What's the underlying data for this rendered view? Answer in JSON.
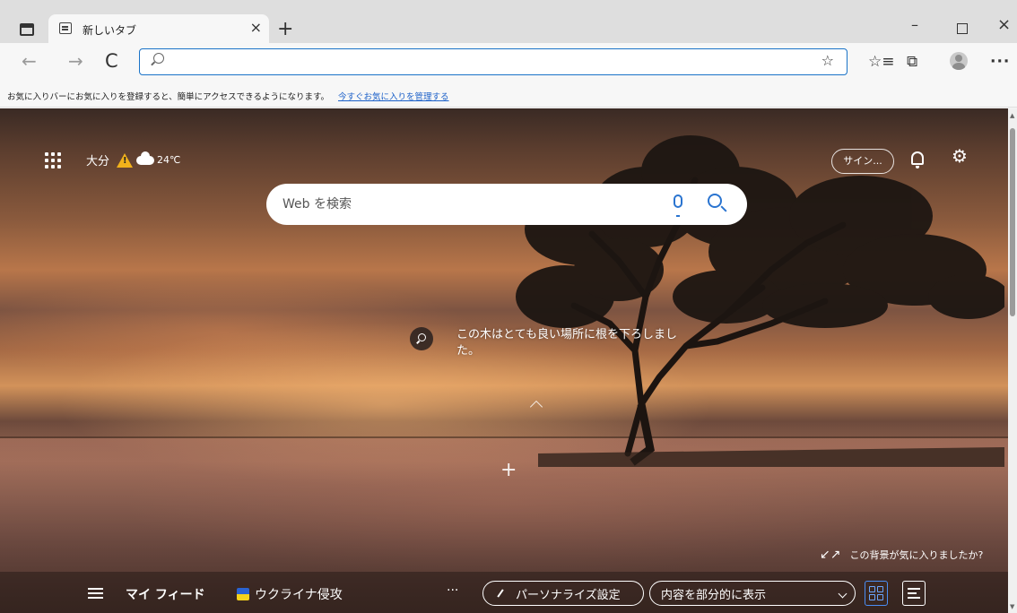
{
  "tab": {
    "title": "新しいタブ",
    "close_glyph": "×"
  },
  "new_tab_glyph": "+",
  "window": {
    "minimize": "–",
    "close": "×"
  },
  "toolbar": {
    "back": "←",
    "forward": "→",
    "refresh": "C",
    "address_value": "",
    "favorite_star": "☆",
    "favorites_glyph": "☆≡",
    "collections_glyph": "⧉",
    "more": "···"
  },
  "favorites_bar": {
    "message": "お気に入りバーにお気に入りを登録すると、簡単にアクセスできるようになります。",
    "link": "今すぐお気に入りを管理する"
  },
  "header": {
    "weather_city": "大分",
    "weather_temp": "24℃",
    "signin_label": "サイン...",
    "settings_glyph": "⚙"
  },
  "search": {
    "placeholder": "Web を検索"
  },
  "background": {
    "caption": "この木はとても良い場所に根を下ろしました。",
    "like_question": "この背景が気に入りましたか?",
    "expand_glyph": "↙↗",
    "plus_glyph": "+"
  },
  "feed_bar": {
    "my_feed": "マイ フィード",
    "topic": "ウクライナ侵攻",
    "more": "···",
    "personalize": "パーソナライズ設定",
    "display_option": "内容を部分的に表示"
  },
  "colors": {
    "accent": "#1a73c8",
    "feed_active": "#4a8ef5"
  }
}
